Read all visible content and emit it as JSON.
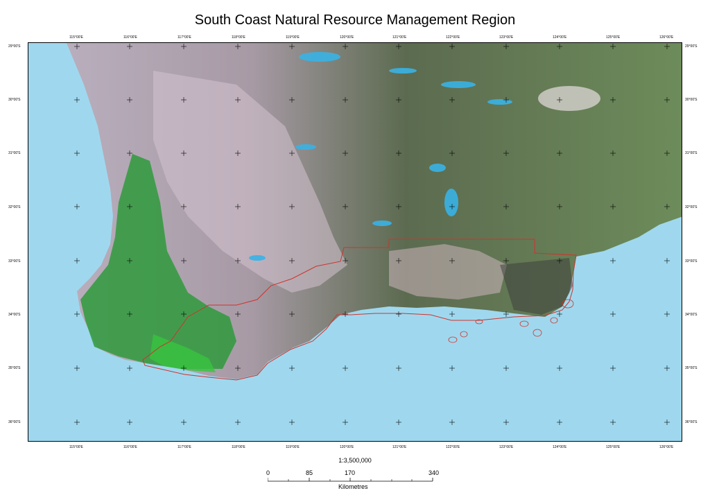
{
  "map": {
    "title": "South Coast Natural Resource Management Region",
    "longitude_labels": [
      "115°00'E",
      "116°00'E",
      "117°00'E",
      "118°00'E",
      "119°00'E",
      "120°00'E",
      "121°00'E",
      "122°00'E",
      "123°00'E",
      "124°00'E",
      "125°00'E",
      "126°00'E"
    ],
    "latitude_labels": [
      "29°00'S",
      "30°00'S",
      "31°00'S",
      "32°00'S",
      "33°00'S",
      "34°00'S",
      "35°00'S",
      "36°00'S"
    ],
    "colors": {
      "ocean": "#9fd8ee",
      "boundary": "#d0322d",
      "forest": "#2e9a3a",
      "farmland": "#c9b8c4",
      "arid": "#5a6e4e"
    }
  },
  "scale": {
    "ratio": "1:3,500,000",
    "labels": [
      "0",
      "85",
      "170",
      "340"
    ],
    "unit": "Kilometres"
  }
}
